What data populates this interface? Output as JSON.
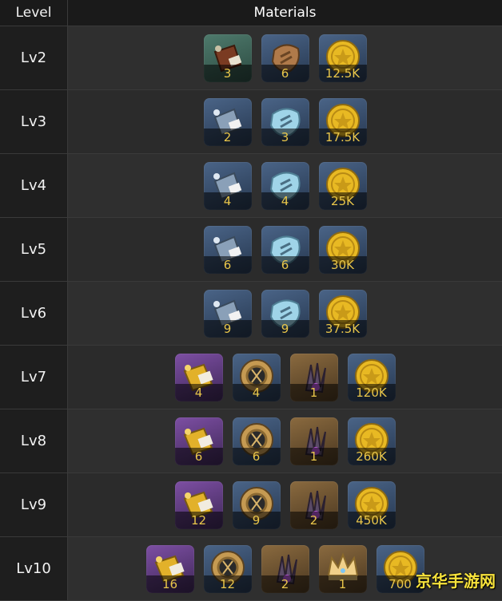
{
  "header": {
    "level": "Level",
    "materials": "Materials"
  },
  "rows": [
    {
      "level": "Lv2",
      "items": [
        {
          "icon": "brown-scroll-icon",
          "bg": "green",
          "qty": "3"
        },
        {
          "icon": "brown-ore-icon",
          "bg": "blue",
          "qty": "6"
        },
        {
          "icon": "gold-coin-icon",
          "bg": "blue",
          "qty": "12.5K"
        }
      ]
    },
    {
      "level": "Lv3",
      "items": [
        {
          "icon": "silver-scroll-icon",
          "bg": "blue",
          "qty": "2"
        },
        {
          "icon": "crystal-ore-icon",
          "bg": "blue",
          "qty": "3"
        },
        {
          "icon": "gold-coin-icon",
          "bg": "blue",
          "qty": "17.5K"
        }
      ]
    },
    {
      "level": "Lv4",
      "items": [
        {
          "icon": "silver-scroll-icon",
          "bg": "blue",
          "qty": "4"
        },
        {
          "icon": "crystal-ore-icon",
          "bg": "blue",
          "qty": "4"
        },
        {
          "icon": "gold-coin-icon",
          "bg": "blue",
          "qty": "25K"
        }
      ]
    },
    {
      "level": "Lv5",
      "items": [
        {
          "icon": "silver-scroll-icon",
          "bg": "blue",
          "qty": "6"
        },
        {
          "icon": "crystal-ore-icon",
          "bg": "blue",
          "qty": "6"
        },
        {
          "icon": "gold-coin-icon",
          "bg": "blue",
          "qty": "30K"
        }
      ]
    },
    {
      "level": "Lv6",
      "items": [
        {
          "icon": "silver-scroll-icon",
          "bg": "blue",
          "qty": "9"
        },
        {
          "icon": "crystal-ore-icon",
          "bg": "blue",
          "qty": "9"
        },
        {
          "icon": "gold-coin-icon",
          "bg": "blue",
          "qty": "37.5K"
        }
      ]
    },
    {
      "level": "Lv7",
      "items": [
        {
          "icon": "gold-scroll-icon",
          "bg": "purple",
          "qty": "4"
        },
        {
          "icon": "gold-ring-icon",
          "bg": "blue",
          "qty": "4"
        },
        {
          "icon": "dark-claw-icon",
          "bg": "gold",
          "qty": "1"
        },
        {
          "icon": "gold-coin-icon",
          "bg": "blue",
          "qty": "120K"
        }
      ]
    },
    {
      "level": "Lv8",
      "items": [
        {
          "icon": "gold-scroll-icon",
          "bg": "purple",
          "qty": "6"
        },
        {
          "icon": "gold-ring-icon",
          "bg": "blue",
          "qty": "6"
        },
        {
          "icon": "dark-claw-icon",
          "bg": "gold",
          "qty": "1"
        },
        {
          "icon": "gold-coin-icon",
          "bg": "blue",
          "qty": "260K"
        }
      ]
    },
    {
      "level": "Lv9",
      "items": [
        {
          "icon": "gold-scroll-icon",
          "bg": "purple",
          "qty": "12"
        },
        {
          "icon": "gold-ring-icon",
          "bg": "blue",
          "qty": "9"
        },
        {
          "icon": "dark-claw-icon",
          "bg": "gold",
          "qty": "2"
        },
        {
          "icon": "gold-coin-icon",
          "bg": "blue",
          "qty": "450K"
        }
      ]
    },
    {
      "level": "Lv10",
      "items": [
        {
          "icon": "gold-scroll-icon",
          "bg": "purple",
          "qty": "16"
        },
        {
          "icon": "gold-ring-icon",
          "bg": "blue",
          "qty": "12"
        },
        {
          "icon": "dark-claw-icon",
          "bg": "gold",
          "qty": "2"
        },
        {
          "icon": "crown-icon",
          "bg": "gold",
          "qty": "1"
        },
        {
          "icon": "gold-coin-icon",
          "bg": "blue",
          "qty": "700"
        }
      ]
    }
  ],
  "watermark": "京华手游网"
}
